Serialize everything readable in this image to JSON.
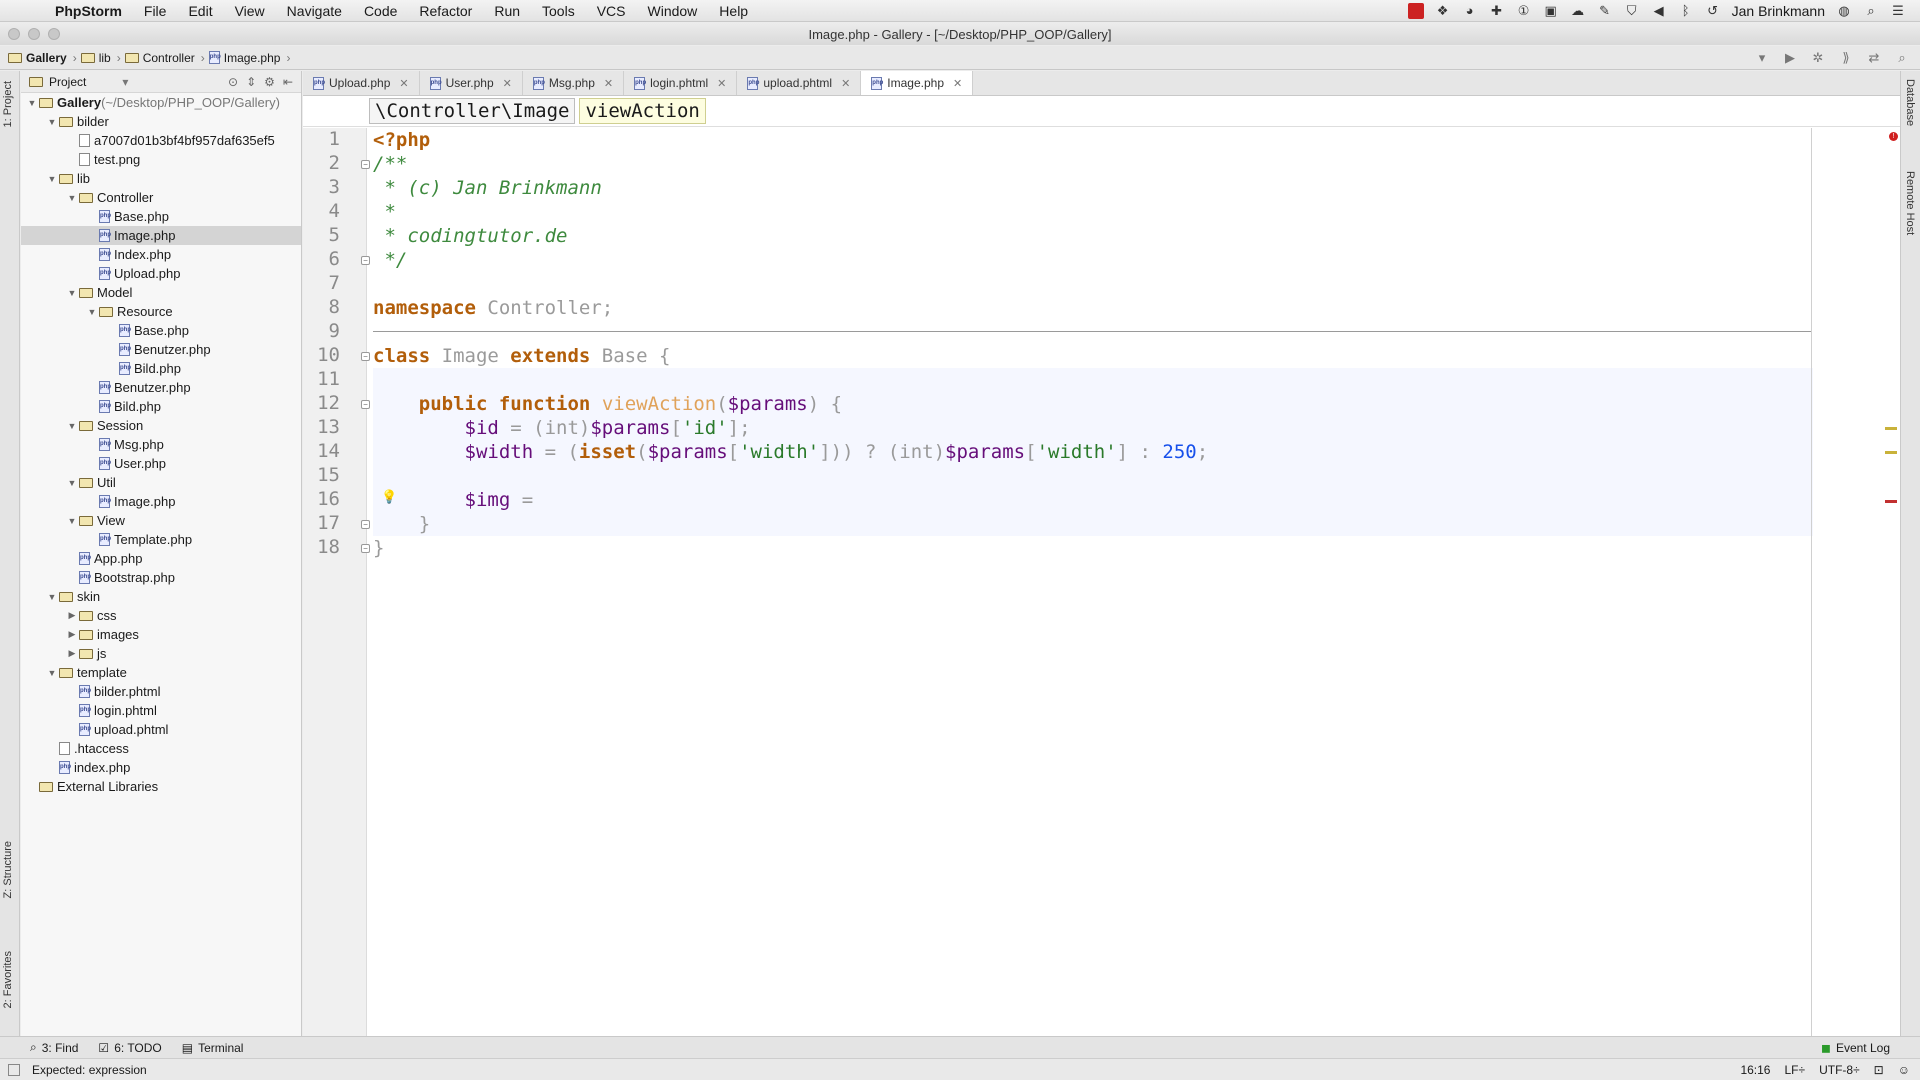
{
  "menubar": {
    "app_name": "PhpStorm",
    "items": [
      "File",
      "Edit",
      "View",
      "Navigate",
      "Code",
      "Refactor",
      "Run",
      "Tools",
      "VCS",
      "Window",
      "Help"
    ],
    "user": "Jan Brinkmann"
  },
  "window": {
    "title": "Image.php - Gallery - [~/Desktop/PHP_OOP/Gallery]"
  },
  "navbar": {
    "crumbs": [
      "Gallery",
      "lib",
      "Controller",
      "Image.php"
    ]
  },
  "side_tabs": {
    "project": "1: Project",
    "structure": "Z: Structure",
    "favorites": "2: Favorites",
    "database": "Database",
    "remote_host": "Remote Host"
  },
  "project_panel": {
    "title": "Project",
    "tree": [
      {
        "label": "Gallery",
        "suffix": " (~/Desktop/PHP_OOP/Gallery)",
        "depth": 0,
        "kind": "folder",
        "expanded": true
      },
      {
        "label": "bilder",
        "depth": 1,
        "kind": "folder",
        "expanded": true
      },
      {
        "label": "a7007d01b3bf4bf957daf635ef5",
        "depth": 2,
        "kind": "file"
      },
      {
        "label": "test.png",
        "depth": 2,
        "kind": "file"
      },
      {
        "label": "lib",
        "depth": 1,
        "kind": "folder",
        "expanded": true
      },
      {
        "label": "Controller",
        "depth": 2,
        "kind": "folder",
        "expanded": true
      },
      {
        "label": "Base.php",
        "depth": 3,
        "kind": "php"
      },
      {
        "label": "Image.php",
        "depth": 3,
        "kind": "php",
        "selected": true
      },
      {
        "label": "Index.php",
        "depth": 3,
        "kind": "php"
      },
      {
        "label": "Upload.php",
        "depth": 3,
        "kind": "php"
      },
      {
        "label": "Model",
        "depth": 2,
        "kind": "folder",
        "expanded": true
      },
      {
        "label": "Resource",
        "depth": 3,
        "kind": "folder",
        "expanded": true
      },
      {
        "label": "Base.php",
        "depth": 4,
        "kind": "php"
      },
      {
        "label": "Benutzer.php",
        "depth": 4,
        "kind": "php"
      },
      {
        "label": "Bild.php",
        "depth": 4,
        "kind": "php"
      },
      {
        "label": "Benutzer.php",
        "depth": 3,
        "kind": "php"
      },
      {
        "label": "Bild.php",
        "depth": 3,
        "kind": "php"
      },
      {
        "label": "Session",
        "depth": 2,
        "kind": "folder",
        "expanded": true
      },
      {
        "label": "Msg.php",
        "depth": 3,
        "kind": "php"
      },
      {
        "label": "User.php",
        "depth": 3,
        "kind": "php"
      },
      {
        "label": "Util",
        "depth": 2,
        "kind": "folder",
        "expanded": true
      },
      {
        "label": "Image.php",
        "depth": 3,
        "kind": "php"
      },
      {
        "label": "View",
        "depth": 2,
        "kind": "folder",
        "expanded": true
      },
      {
        "label": "Template.php",
        "depth": 3,
        "kind": "php"
      },
      {
        "label": "App.php",
        "depth": 2,
        "kind": "php"
      },
      {
        "label": "Bootstrap.php",
        "depth": 2,
        "kind": "php"
      },
      {
        "label": "skin",
        "depth": 1,
        "kind": "folder",
        "expanded": true
      },
      {
        "label": "css",
        "depth": 2,
        "kind": "folder",
        "expanded": false
      },
      {
        "label": "images",
        "depth": 2,
        "kind": "folder",
        "expanded": false
      },
      {
        "label": "js",
        "depth": 2,
        "kind": "folder",
        "expanded": false
      },
      {
        "label": "template",
        "depth": 1,
        "kind": "folder",
        "expanded": true
      },
      {
        "label": "bilder.phtml",
        "depth": 2,
        "kind": "php"
      },
      {
        "label": "login.phtml",
        "depth": 2,
        "kind": "php"
      },
      {
        "label": "upload.phtml",
        "depth": 2,
        "kind": "php"
      },
      {
        "label": ".htaccess",
        "depth": 1,
        "kind": "file"
      },
      {
        "label": "index.php",
        "depth": 1,
        "kind": "php"
      },
      {
        "label": "External Libraries",
        "depth": 0,
        "kind": "lib"
      }
    ]
  },
  "editor": {
    "tabs": [
      {
        "label": "Upload.php",
        "active": false
      },
      {
        "label": "User.php",
        "active": false
      },
      {
        "label": "Msg.php",
        "active": false
      },
      {
        "label": "login.phtml",
        "active": false
      },
      {
        "label": "upload.phtml",
        "active": false
      },
      {
        "label": "Image.php",
        "active": true
      }
    ],
    "breadcrumb": [
      "\\Controller\\Image",
      "viewAction"
    ],
    "lines": [
      [
        [
          "kw",
          "<?php"
        ]
      ],
      [
        [
          "cm",
          "/**"
        ]
      ],
      [
        [
          "cm",
          " * (c) Jan Brinkmann"
        ]
      ],
      [
        [
          "cm",
          " *"
        ]
      ],
      [
        [
          "cm",
          " * codingtutor.de"
        ]
      ],
      [
        [
          "cm",
          " */"
        ]
      ],
      [],
      [
        [
          "kw",
          "namespace"
        ],
        [
          "dim",
          " Controller;"
        ]
      ],
      [],
      [
        [
          "kw",
          "class"
        ],
        [
          "dim",
          " Image "
        ],
        [
          "kw",
          "extends"
        ],
        [
          "dim",
          " Base {"
        ]
      ],
      [],
      [
        [
          "",
          "    "
        ],
        [
          "kw",
          "public function"
        ],
        [
          "",
          " "
        ],
        [
          "fn",
          "viewAction"
        ],
        [
          "dim",
          "("
        ],
        [
          "var",
          "$params"
        ],
        [
          "dim",
          ") {"
        ]
      ],
      [
        [
          "",
          "        "
        ],
        [
          "var",
          "$id"
        ],
        [
          "dim",
          " = (int)"
        ],
        [
          "var",
          "$params"
        ],
        [
          "dim",
          "["
        ],
        [
          "str",
          "'id'"
        ],
        [
          "dim",
          "];"
        ]
      ],
      [
        [
          "",
          "        "
        ],
        [
          "var",
          "$width"
        ],
        [
          "dim",
          " = ("
        ],
        [
          "kw",
          "isset"
        ],
        [
          "dim",
          "("
        ],
        [
          "var",
          "$params"
        ],
        [
          "dim",
          "["
        ],
        [
          "str",
          "'width'"
        ],
        [
          "dim",
          "])) ? (int)"
        ],
        [
          "var",
          "$params"
        ],
        [
          "dim",
          "["
        ],
        [
          "str",
          "'width'"
        ],
        [
          "dim",
          "] : "
        ],
        [
          "num",
          "250"
        ],
        [
          "dim",
          ";"
        ]
      ],
      [],
      [
        [
          "",
          "        "
        ],
        [
          "var",
          "$img"
        ],
        [
          "dim",
          " = "
        ]
      ],
      [
        [
          "dim",
          "    }"
        ]
      ],
      [
        [
          "dim",
          "}"
        ]
      ]
    ]
  },
  "bottom_tabs": {
    "find": "3: Find",
    "todo": "6: TODO",
    "terminal": "Terminal",
    "event_log": "Event Log"
  },
  "status": {
    "message": "Expected: expression",
    "position": "16:16",
    "line_sep": "LF÷",
    "encoding": "UTF-8÷"
  }
}
